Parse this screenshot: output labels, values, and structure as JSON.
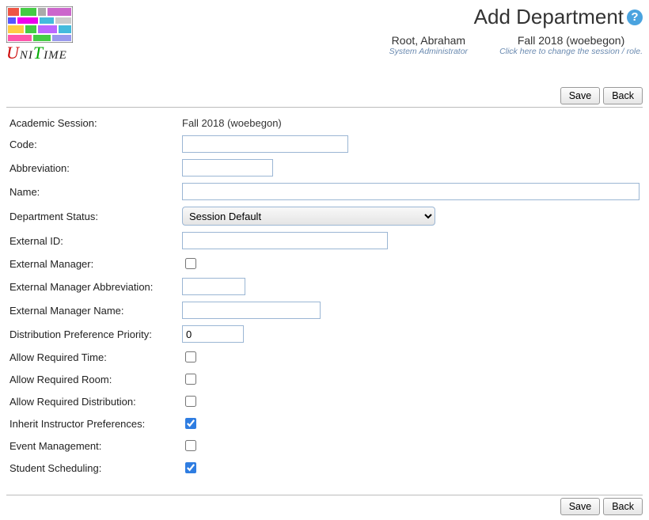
{
  "page_title": "Add Department",
  "user": {
    "name": "Root, Abraham",
    "role": "System Administrator"
  },
  "session": {
    "name": "Fall 2018 (woebegon)",
    "change_hint": "Click here to change the session / role."
  },
  "buttons": {
    "save": "Save",
    "back": "Back"
  },
  "fields": {
    "academic_session": {
      "label": "Academic Session:",
      "value": "Fall 2018 (woebegon)"
    },
    "code": {
      "label": "Code:",
      "value": ""
    },
    "abbreviation": {
      "label": "Abbreviation:",
      "value": ""
    },
    "name": {
      "label": "Name:",
      "value": ""
    },
    "dept_status": {
      "label": "Department Status:",
      "value": "Session Default"
    },
    "external_id": {
      "label": "External ID:",
      "value": ""
    },
    "external_manager": {
      "label": "External Manager:",
      "checked": false
    },
    "ext_mgr_abbrev": {
      "label": "External Manager Abbreviation:",
      "value": ""
    },
    "ext_mgr_name": {
      "label": "External Manager Name:",
      "value": ""
    },
    "dist_pref_priority": {
      "label": "Distribution Preference Priority:",
      "value": "0"
    },
    "allow_req_time": {
      "label": "Allow Required Time:",
      "checked": false
    },
    "allow_req_room": {
      "label": "Allow Required Room:",
      "checked": false
    },
    "allow_req_dist": {
      "label": "Allow Required Distribution:",
      "checked": false
    },
    "inherit_instr_pref": {
      "label": "Inherit Instructor Preferences:",
      "checked": true
    },
    "event_mgmt": {
      "label": "Event Management:",
      "checked": false
    },
    "student_sched": {
      "label": "Student Scheduling:",
      "checked": true
    }
  }
}
